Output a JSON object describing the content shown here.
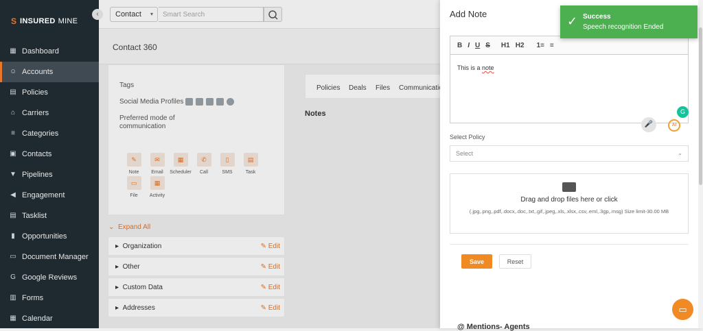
{
  "brand": {
    "name_bold": "INSURED",
    "name_rest": "MINE"
  },
  "sidebar": {
    "items": [
      {
        "label": "Dashboard",
        "icon": "dashboard-icon"
      },
      {
        "label": "Accounts",
        "icon": "accounts-icon",
        "active": true
      },
      {
        "label": "Policies",
        "icon": "policies-icon"
      },
      {
        "label": "Carriers",
        "icon": "carriers-icon"
      },
      {
        "label": "Categories",
        "icon": "categories-icon"
      },
      {
        "label": "Contacts",
        "icon": "contacts-icon"
      },
      {
        "label": "Pipelines",
        "icon": "pipelines-icon"
      },
      {
        "label": "Engagement",
        "icon": "engagement-icon"
      },
      {
        "label": "Tasklist",
        "icon": "tasklist-icon"
      },
      {
        "label": "Opportunities",
        "icon": "opportunities-icon"
      },
      {
        "label": "Document Manager",
        "icon": "folder-icon"
      },
      {
        "label": "Google Reviews",
        "icon": "google-icon"
      },
      {
        "label": "Forms",
        "icon": "forms-icon"
      },
      {
        "label": "Calendar",
        "icon": "calendar-icon"
      }
    ]
  },
  "topbar": {
    "contact_type": "Contact",
    "search_placeholder": "Smart Search"
  },
  "page": {
    "title": "Contact 360"
  },
  "contact_card": {
    "tags_label": "Tags",
    "social_label": "Social Media Profiles",
    "preferred_label_1": "Preferred mode of",
    "preferred_label_2": "communication",
    "actions": [
      "Note",
      "Email",
      "Scheduler",
      "Call",
      "SMS",
      "Task",
      "File",
      "Activity"
    ]
  },
  "expand_all": "Expand All",
  "sections": [
    {
      "label": "Organization",
      "edit": "Edit"
    },
    {
      "label": "Other",
      "edit": "Edit"
    },
    {
      "label": "Custom Data",
      "edit": "Edit"
    },
    {
      "label": "Addresses",
      "edit": "Edit"
    }
  ],
  "tabs": [
    "Policies",
    "Deals",
    "Files",
    "Communicatio"
  ],
  "notes_heading": "Notes",
  "add_note": {
    "title": "Add Note",
    "toolbar": [
      "B",
      "I",
      "U",
      "S",
      "H1",
      "H2",
      "1≡",
      "≡"
    ],
    "text_prefix": "This is a ",
    "text_underlined": "note",
    "select_policy_label": "Select Policy",
    "select_placeholder": "Select",
    "drop_title": "Drag and drop files here or click",
    "drop_formats": "(.jpg,.png,.pdf,.docx,.doc,.txt,.gif,.jpeg,.xls,.xlsx,.csv,.eml,.3gp,.msg) Size limit-30.00 MB",
    "save": "Save",
    "reset": "Reset",
    "mentions": "@ Mentions- Agents"
  },
  "toast": {
    "title": "Success",
    "message": "Speech recognition Ended",
    "color": "#4caf50"
  }
}
